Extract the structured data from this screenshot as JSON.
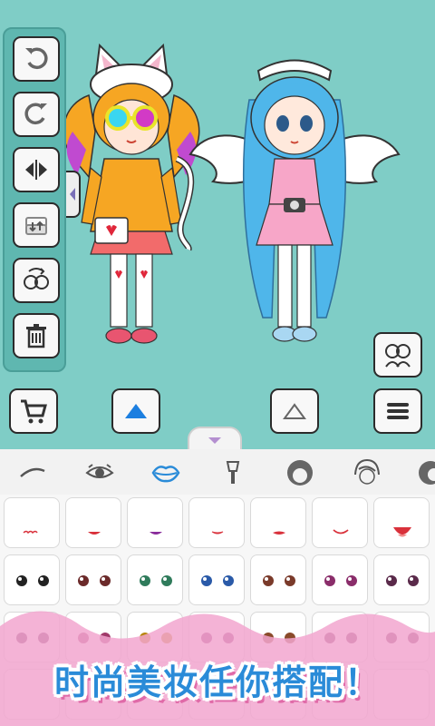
{
  "canvas": {
    "background": "#7fcdc6"
  },
  "toolbar": {
    "buttons": [
      {
        "id": "undo",
        "icon": "undo-icon"
      },
      {
        "id": "redo",
        "icon": "redo-icon"
      },
      {
        "id": "flip",
        "icon": "flip-horizontal-icon"
      },
      {
        "id": "layer",
        "icon": "layer-swap-icon"
      },
      {
        "id": "swap-character",
        "icon": "swap-faces-icon"
      },
      {
        "id": "delete",
        "icon": "trash-icon"
      }
    ]
  },
  "bottom_controls": {
    "cart_icon": "cart-icon",
    "move_up_icon": "triangle-up-filled-icon",
    "move_down_icon": "triangle-up-outline-icon",
    "menu_icon": "hamburger-menu-icon",
    "characters_icon": "two-characters-icon"
  },
  "category_tabs": [
    {
      "id": "eyebrows",
      "icon": "eyebrow-icon",
      "active": false
    },
    {
      "id": "eyes",
      "icon": "eye-icon",
      "active": false
    },
    {
      "id": "lips",
      "icon": "lips-icon",
      "active": true
    },
    {
      "id": "brush",
      "icon": "makeup-brush-icon",
      "active": false
    },
    {
      "id": "hair-back",
      "icon": "hair-icon",
      "active": false
    },
    {
      "id": "hair-front",
      "icon": "hair-bangs-icon",
      "active": false
    },
    {
      "id": "hair-side",
      "icon": "hair-side-icon",
      "active": false
    }
  ],
  "colors": {
    "accent": "#2a8bd8",
    "pink": "#f2a6cf",
    "lip_red": "#d9313b",
    "purple": "#8a2d9c"
  },
  "banner": {
    "text": "时尚美妆任你搭配！"
  }
}
